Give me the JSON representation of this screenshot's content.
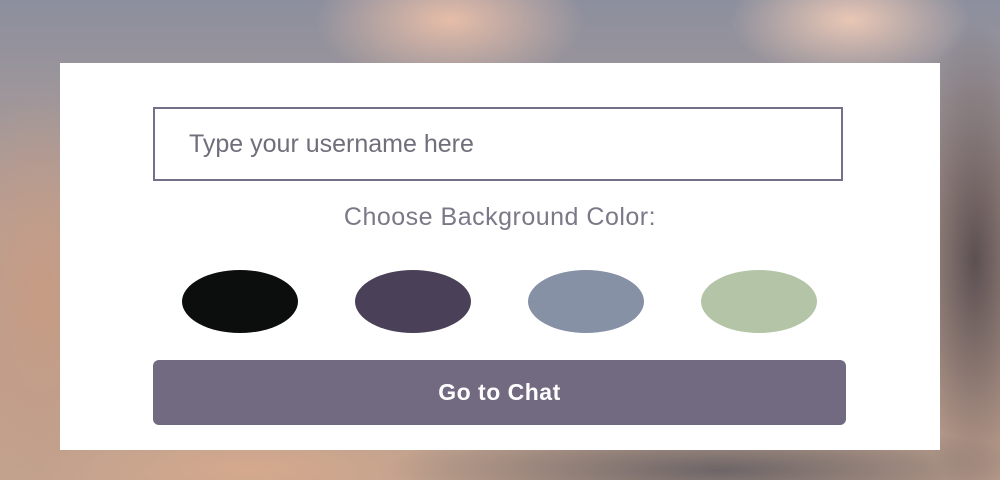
{
  "form": {
    "username_placeholder": "Type your username here",
    "choose_label": "Choose Background Color:",
    "submit_label": "Go to Chat"
  },
  "colors": {
    "options": [
      "#0b0e0c",
      "#4a4158",
      "#8791a5",
      "#b4c5a7"
    ],
    "button": "#716a80"
  }
}
